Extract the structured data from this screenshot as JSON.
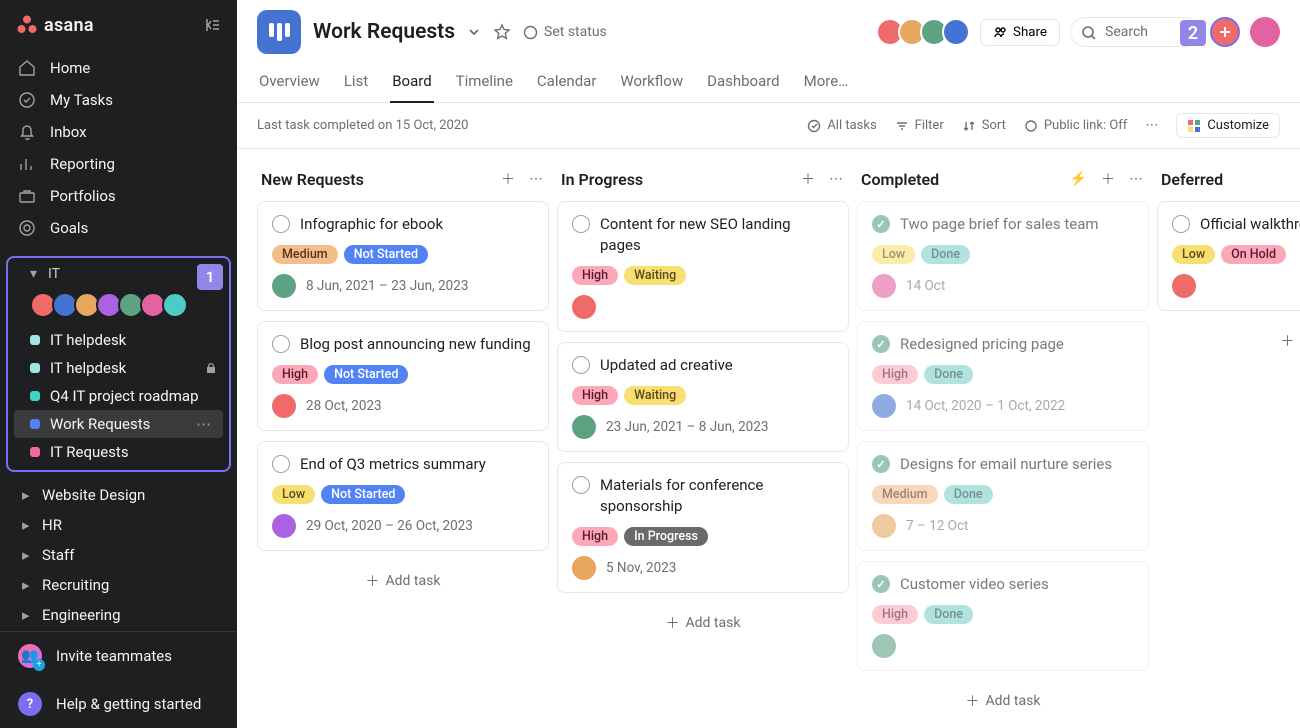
{
  "app": {
    "logo_word": "asana"
  },
  "sidebar": {
    "nav": [
      {
        "icon": "home",
        "label": "Home"
      },
      {
        "icon": "check-circle",
        "label": "My Tasks"
      },
      {
        "icon": "bell",
        "label": "Inbox"
      },
      {
        "icon": "bar",
        "label": "Reporting"
      },
      {
        "icon": "briefcase",
        "label": "Portfolios"
      },
      {
        "icon": "target",
        "label": "Goals"
      }
    ],
    "section": {
      "title": "IT",
      "badge": "1",
      "projects": [
        {
          "dot": "#9ee7e3",
          "label": "IT helpdesk",
          "lock": false
        },
        {
          "dot": "#9ee7e3",
          "label": "IT helpdesk",
          "lock": true
        },
        {
          "dot": "#3ed3c5",
          "label": "Q4 IT project roadmap"
        },
        {
          "dot": "#5183f5",
          "label": "Work Requests",
          "active": true
        },
        {
          "dot": "#f06aa0",
          "label": "IT Requests"
        }
      ]
    },
    "teams": [
      "Website Design",
      "HR",
      "Staff",
      "Recruiting",
      "Engineering"
    ],
    "invite": "Invite teammates",
    "help": "Help & getting started"
  },
  "header": {
    "title": "Work Requests",
    "set_status": "Set status",
    "share": "Share",
    "search_placeholder": "Search",
    "plus_badge": "2"
  },
  "tabs": [
    "Overview",
    "List",
    "Board",
    "Timeline",
    "Calendar",
    "Workflow",
    "Dashboard",
    "More…"
  ],
  "tab_active": "Board",
  "toolbar": {
    "meta": "Last task completed on 15 Oct, 2020",
    "all_tasks": "All tasks",
    "filter": "Filter",
    "sort": "Sort",
    "public": "Public link: Off",
    "customize": "Customize"
  },
  "columns": [
    {
      "title": "New Requests",
      "cards": [
        {
          "title": "Infographic for ebook",
          "tags": [
            {
              "t": "medium",
              "l": "Medium"
            },
            {
              "t": "notstarted",
              "l": "Not Started"
            }
          ],
          "assignee": "c4",
          "date": "8 Jun, 2021 – 23 Jun, 2023"
        },
        {
          "title": "Blog post announcing new funding",
          "tags": [
            {
              "t": "high",
              "l": "High"
            },
            {
              "t": "notstarted",
              "l": "Not Started"
            }
          ],
          "assignee": "c0",
          "date": "28 Oct, 2023"
        },
        {
          "title": "End of Q3 metrics summary",
          "tags": [
            {
              "t": "low",
              "l": "Low"
            },
            {
              "t": "notstarted",
              "l": "Not Started"
            }
          ],
          "assignee": "c3",
          "date": "29 Oct, 2020 – 26 Oct, 2023"
        }
      ],
      "add": "Add task"
    },
    {
      "title": "In Progress",
      "cards": [
        {
          "title": "Content for new SEO landing pages",
          "tags": [
            {
              "t": "high",
              "l": "High"
            },
            {
              "t": "waiting",
              "l": "Waiting"
            }
          ],
          "assignee": "c0",
          "date": ""
        },
        {
          "title": "Updated ad creative",
          "tags": [
            {
              "t": "high",
              "l": "High"
            },
            {
              "t": "waiting",
              "l": "Waiting"
            }
          ],
          "assignee": "c4",
          "date": "23 Jun, 2021 – 8 Jun, 2023"
        },
        {
          "title": "Materials for conference sponsorship",
          "tags": [
            {
              "t": "high",
              "l": "High"
            },
            {
              "t": "inprogress",
              "l": "In Progress"
            }
          ],
          "assignee": "c2",
          "date": "5 Nov, 2023"
        }
      ],
      "add": "Add task"
    },
    {
      "title": "Completed",
      "bolt": true,
      "cards": [
        {
          "done": true,
          "title": "Two page brief for sales team",
          "tags": [
            {
              "t": "low",
              "l": "Low"
            },
            {
              "t": "done",
              "l": "Done"
            }
          ],
          "assignee": "c5",
          "date": "14 Oct"
        },
        {
          "done": true,
          "title": "Redesigned pricing page",
          "tags": [
            {
              "t": "high",
              "l": "High"
            },
            {
              "t": "done",
              "l": "Done"
            }
          ],
          "assignee": "c1",
          "date": "14 Oct, 2020 – 1 Oct, 2022"
        },
        {
          "done": true,
          "title": "Designs for email nurture series",
          "tags": [
            {
              "t": "medium",
              "l": "Medium"
            },
            {
              "t": "done",
              "l": "Done"
            }
          ],
          "assignee": "c2",
          "date": "7 – 12 Oct"
        },
        {
          "done": true,
          "title": "Customer video series",
          "tags": [
            {
              "t": "high",
              "l": "High"
            },
            {
              "t": "done",
              "l": "Done"
            }
          ],
          "assignee": "c4",
          "date": ""
        }
      ],
      "add": "Add task"
    },
    {
      "title": "Deferred",
      "cards": [
        {
          "title": "Official walkthrough candidates",
          "tags": [
            {
              "t": "low",
              "l": "Low"
            },
            {
              "t": "onhold",
              "l": "On Hold"
            }
          ],
          "assignee": "c0",
          "date": ""
        }
      ],
      "add": "Add"
    }
  ]
}
